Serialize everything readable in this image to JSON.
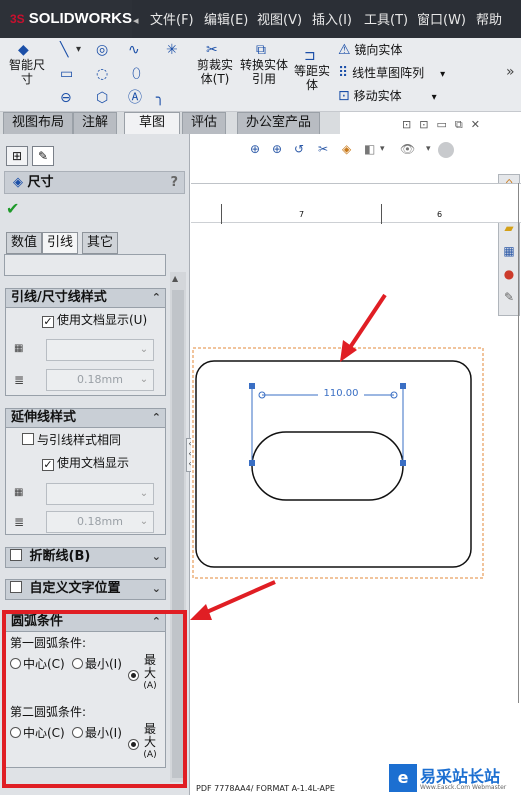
{
  "app": {
    "logo_text": "SOLIDWORKS",
    "logo_prefix": "3S"
  },
  "menu": {
    "items": [
      "文件(F)",
      "编辑(E)",
      "视图(V)",
      "插入(I)",
      "工具(T)",
      "窗口(W)",
      "帮助(H)"
    ],
    "collapse": "◂"
  },
  "toolbar": {
    "smart_dim": "智能尺寸",
    "trim": "剪裁实体(T)",
    "convert": "转换实体引用",
    "offset": "等距实体",
    "mirror": "镜向实体",
    "linear_pattern": "线性草图阵列",
    "move": "移动实体",
    "more": "»"
  },
  "tabs": [
    "视图布局",
    "注解",
    "草图",
    "评估",
    "办公室产品"
  ],
  "panel": {
    "title": "尺寸",
    "help": "?",
    "confirm": "✔",
    "subtabs": [
      "数值",
      "引线",
      "其它"
    ],
    "leader_group": {
      "title": "引线/尺寸线样式",
      "use_doc": "使用文档显示(U)",
      "width": "0.18mm"
    },
    "ext_group": {
      "title": "延伸线样式",
      "same_as_leader": "与引线样式相同",
      "use_doc": "使用文档显示",
      "width": "0.18mm"
    },
    "break_group": {
      "title": "折断线(B)"
    },
    "custom_pos": {
      "title": "自定义文字位置"
    },
    "arc_group": {
      "title": "圆弧条件",
      "first": "第一圆弧条件:",
      "second": "第二圆弧条件:",
      "center": "中心(C)",
      "min": "最小(I)",
      "max_a": "最",
      "max_b": "大",
      "max_c": "(A)"
    }
  },
  "canvas": {
    "dimension": "110.00",
    "ruler_marks": [
      "7",
      "6"
    ]
  },
  "status": {
    "text": "PDF 7778AA4/ FORMAT A-1.4L-APE"
  },
  "watermark": {
    "text": "易采站长站",
    "sub": "Www.Easck.Com Webmaster"
  },
  "colors": {
    "annotation_red": "#e01e24",
    "dim_blue": "#3a6fc4"
  }
}
